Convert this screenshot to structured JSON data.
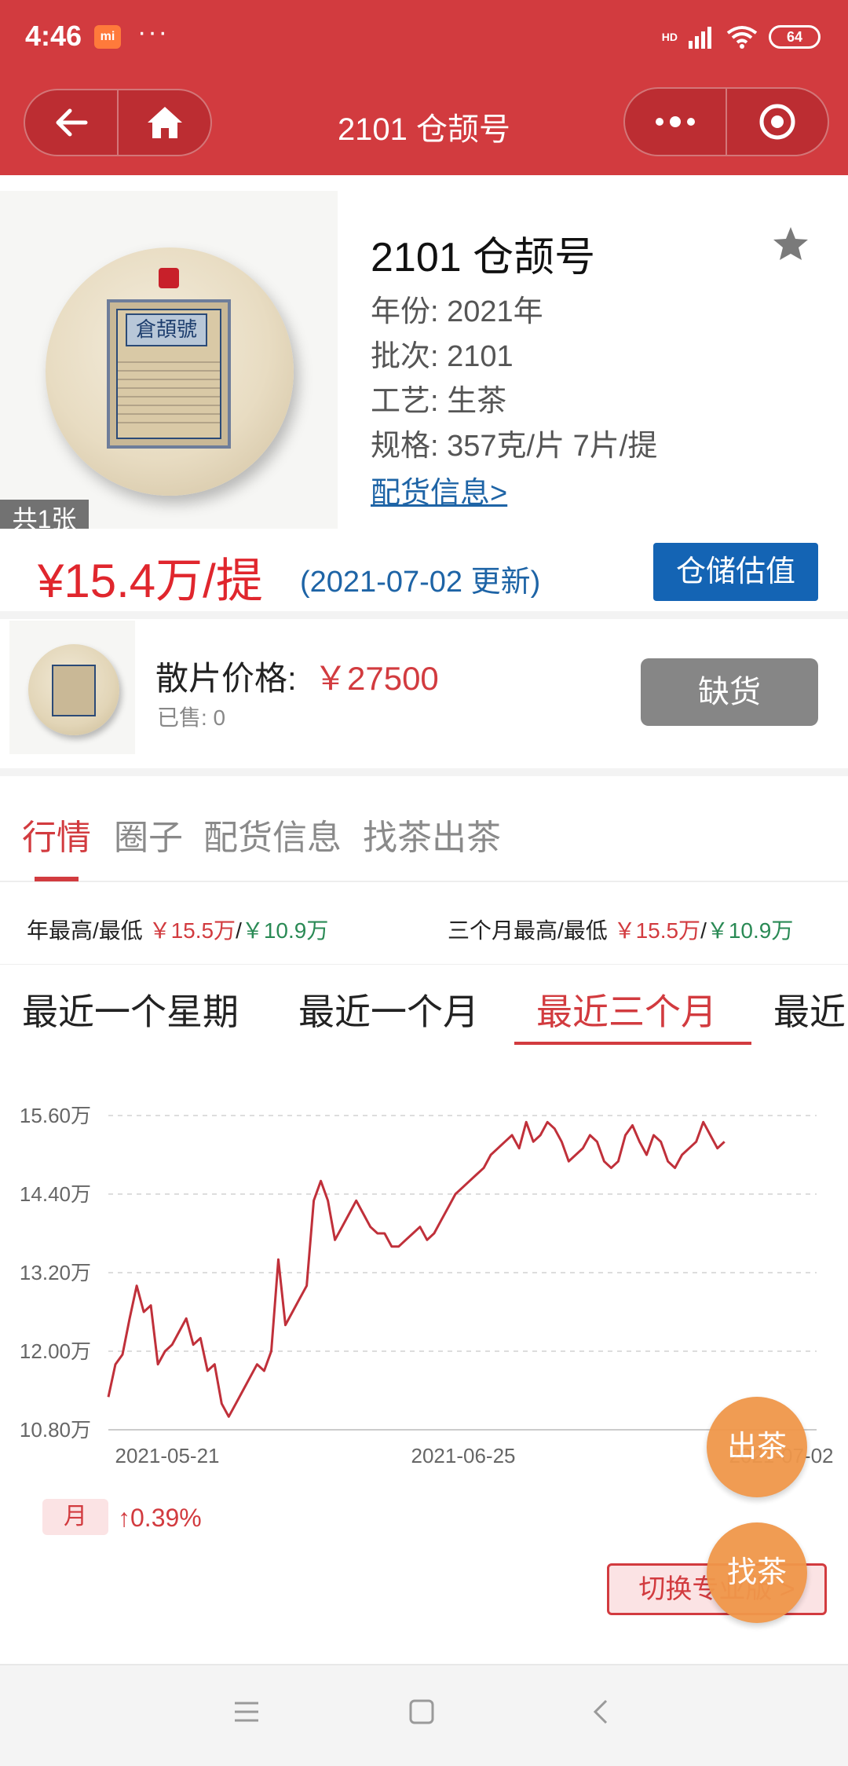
{
  "status_bar": {
    "time": "4:46",
    "mi_badge": "mi",
    "dots": "···",
    "hd": "HD",
    "battery": "64"
  },
  "nav": {
    "title": "2101 仓颉号",
    "back_icon": "arrow-left-icon",
    "home_icon": "home-icon",
    "more_icon": "more-dots-icon",
    "close_icon": "target-icon"
  },
  "product": {
    "name": "2101 仓颉号",
    "image_count": "共1张",
    "label_text": "倉頡號",
    "attrs": [
      "年份: 2021年",
      "批次: 2101",
      "工艺: 生茶",
      "规格: 357克/片 7片/提"
    ],
    "link": "配货信息>",
    "price": "¥15.4万/提",
    "price_date": "(2021-07-02 更新)",
    "storage_button": "仓储估值"
  },
  "loose": {
    "label": "散片价格:",
    "value": "￥27500",
    "sold": "已售: 0",
    "button": "缺货"
  },
  "tabs": [
    "行情",
    "圈子",
    "配货信息",
    "找茶出茶"
  ],
  "active_tab": "行情",
  "stats": {
    "year_label": "年最高/最低",
    "year_high": "￥15.5万",
    "year_low": "￥10.9万",
    "q_label": "三个月最高/最低",
    "q_high": "￥15.5万",
    "q_low": "￥10.9万",
    "sep": "/"
  },
  "periods": [
    "最近一个星期",
    "最近一个月",
    "最近三个月",
    "最近"
  ],
  "active_period": "最近三个月",
  "chart_data": {
    "type": "line",
    "y_ticks": [
      "15.60万",
      "14.40万",
      "13.20万",
      "12.00万",
      "10.80万"
    ],
    "x_ticks": [
      "2021-05-21",
      "2021-06-25",
      "2021-07-02"
    ],
    "ylim": [
      10.8,
      15.6
    ],
    "xlim": [
      0,
      100
    ],
    "grid": true,
    "color": "#c0303a",
    "series": [
      {
        "values": [
          [
            0,
            11.3
          ],
          [
            1,
            11.8
          ],
          [
            2,
            11.95
          ],
          [
            3,
            12.5
          ],
          [
            4,
            13.0
          ],
          [
            5,
            12.6
          ],
          [
            6,
            12.7
          ],
          [
            7,
            11.8
          ],
          [
            8,
            12.0
          ],
          [
            9,
            12.1
          ],
          [
            10,
            12.3
          ],
          [
            11,
            12.5
          ],
          [
            12,
            12.1
          ],
          [
            13,
            12.2
          ],
          [
            14,
            11.7
          ],
          [
            15,
            11.8
          ],
          [
            16,
            11.2
          ],
          [
            17,
            11.0
          ],
          [
            18,
            11.2
          ],
          [
            19,
            11.4
          ],
          [
            20,
            11.6
          ],
          [
            21,
            11.8
          ],
          [
            22,
            11.7
          ],
          [
            23,
            12.0
          ],
          [
            24,
            13.4
          ],
          [
            25,
            12.4
          ],
          [
            26,
            12.6
          ],
          [
            27,
            12.8
          ],
          [
            28,
            13.0
          ],
          [
            29,
            14.3
          ],
          [
            30,
            14.6
          ],
          [
            31,
            14.3
          ],
          [
            32,
            13.7
          ],
          [
            33,
            13.9
          ],
          [
            34,
            14.1
          ],
          [
            35,
            14.3
          ],
          [
            36,
            14.1
          ],
          [
            37,
            13.9
          ],
          [
            38,
            13.8
          ],
          [
            39,
            13.8
          ],
          [
            40,
            13.6
          ],
          [
            41,
            13.6
          ],
          [
            42,
            13.7
          ],
          [
            43,
            13.8
          ],
          [
            44,
            13.9
          ],
          [
            45,
            13.7
          ],
          [
            46,
            13.8
          ],
          [
            47,
            14.0
          ],
          [
            48,
            14.2
          ],
          [
            49,
            14.4
          ],
          [
            50,
            14.5
          ],
          [
            51,
            14.6
          ],
          [
            52,
            14.7
          ],
          [
            53,
            14.8
          ],
          [
            54,
            15.0
          ],
          [
            55,
            15.1
          ],
          [
            56,
            15.2
          ],
          [
            57,
            15.3
          ],
          [
            58,
            15.1
          ],
          [
            59,
            15.5
          ],
          [
            60,
            15.2
          ],
          [
            61,
            15.3
          ],
          [
            62,
            15.5
          ],
          [
            63,
            15.4
          ],
          [
            64,
            15.2
          ],
          [
            65,
            14.9
          ],
          [
            66,
            15.0
          ],
          [
            67,
            15.1
          ],
          [
            68,
            15.3
          ],
          [
            69,
            15.2
          ],
          [
            70,
            14.9
          ],
          [
            71,
            14.8
          ],
          [
            72,
            14.9
          ],
          [
            73,
            15.3
          ],
          [
            74,
            15.45
          ],
          [
            75,
            15.2
          ],
          [
            76,
            15.0
          ],
          [
            77,
            15.3
          ],
          [
            78,
            15.2
          ],
          [
            79,
            14.9
          ],
          [
            80,
            14.8
          ],
          [
            81,
            15.0
          ],
          [
            82,
            15.1
          ],
          [
            83,
            15.2
          ],
          [
            84,
            15.5
          ],
          [
            85,
            15.3
          ],
          [
            86,
            15.1
          ],
          [
            87,
            15.2
          ]
        ]
      }
    ]
  },
  "change": {
    "tag": "月",
    "value": "↑0.39%"
  },
  "switch_button": "切换专业版 >",
  "fab_out": "出茶",
  "fab_find": "找茶",
  "colors": {
    "brand_red": "#d23b3f",
    "price_red": "#e0262d",
    "link_blue": "#1e64a6",
    "button_blue": "#1464b4",
    "low_green": "#2a8a55",
    "fab_orange": "#f0974a"
  }
}
